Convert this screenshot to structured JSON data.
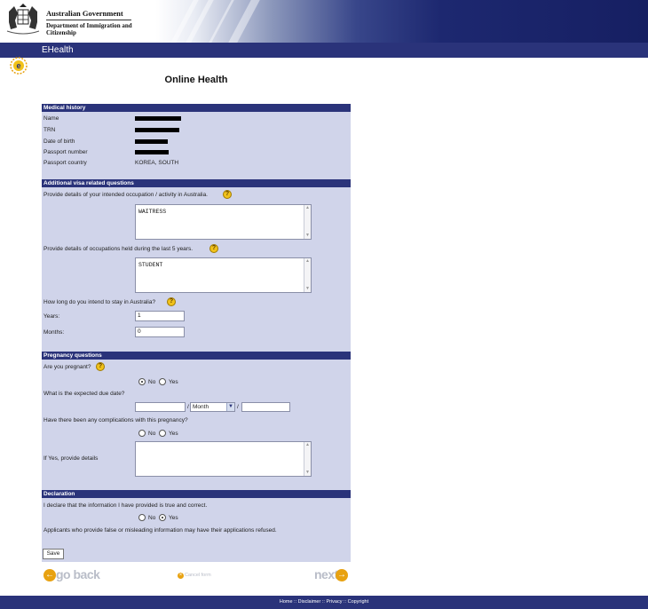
{
  "header": {
    "gov_title": "Australian Government",
    "department": "Department of Immigration and Citizenship",
    "app_name": "EHealth"
  },
  "page_title": "Online Health",
  "medical_history": {
    "title": "Medical history",
    "name_label": "Name",
    "trn_label": "TRN",
    "dob_label": "Date of birth",
    "passport_number_label": "Passport number",
    "passport_country_label": "Passport country",
    "passport_country_value": "KOREA, SOUTH"
  },
  "visa_questions": {
    "title": "Additional visa related questions",
    "occupation_question": "Provide details of your intended occupation / activity in Australia.",
    "occupation_value": "WAITRESS",
    "past_occupations_question": "Provide details of occupations held during the last 5 years.",
    "past_occupations_value": "STUDENT",
    "stay_question": "How long do you intend to stay in Australia?",
    "years_label": "Years:",
    "years_value": "1",
    "months_label": "Months:",
    "months_value": "0"
  },
  "pregnancy": {
    "title": "Pregnancy questions",
    "pregnant_question": "Are you pregnant?",
    "pregnant_selected": "No",
    "no_label": "No",
    "yes_label": "Yes",
    "due_date_question": "What is the expected due date?",
    "month_placeholder": "Month",
    "date_separator": "/",
    "complications_question": "Have there been any complications with this pregnancy?",
    "details_label": "If Yes, provide details"
  },
  "declaration": {
    "title": "Declaration",
    "statement": "I declare that the information I have provided is true and correct.",
    "selected": "Yes",
    "warning": "Applicants who provide false or misleading information may have their applications refused."
  },
  "actions": {
    "save_label": "Save",
    "back_label": "go back",
    "cancel_label": "Cancel form",
    "next_label": "next"
  },
  "footer": {
    "home": "Home",
    "disclaimer": "Disclaimer",
    "privacy": "Privacy",
    "copyright": "Copyright",
    "separator": "::"
  },
  "colors": {
    "header_navy": "#2a337a",
    "panel_lavender": "#d0d4ea",
    "help_yellow": "#f1c21b",
    "arrow_orange": "#e8a211"
  }
}
